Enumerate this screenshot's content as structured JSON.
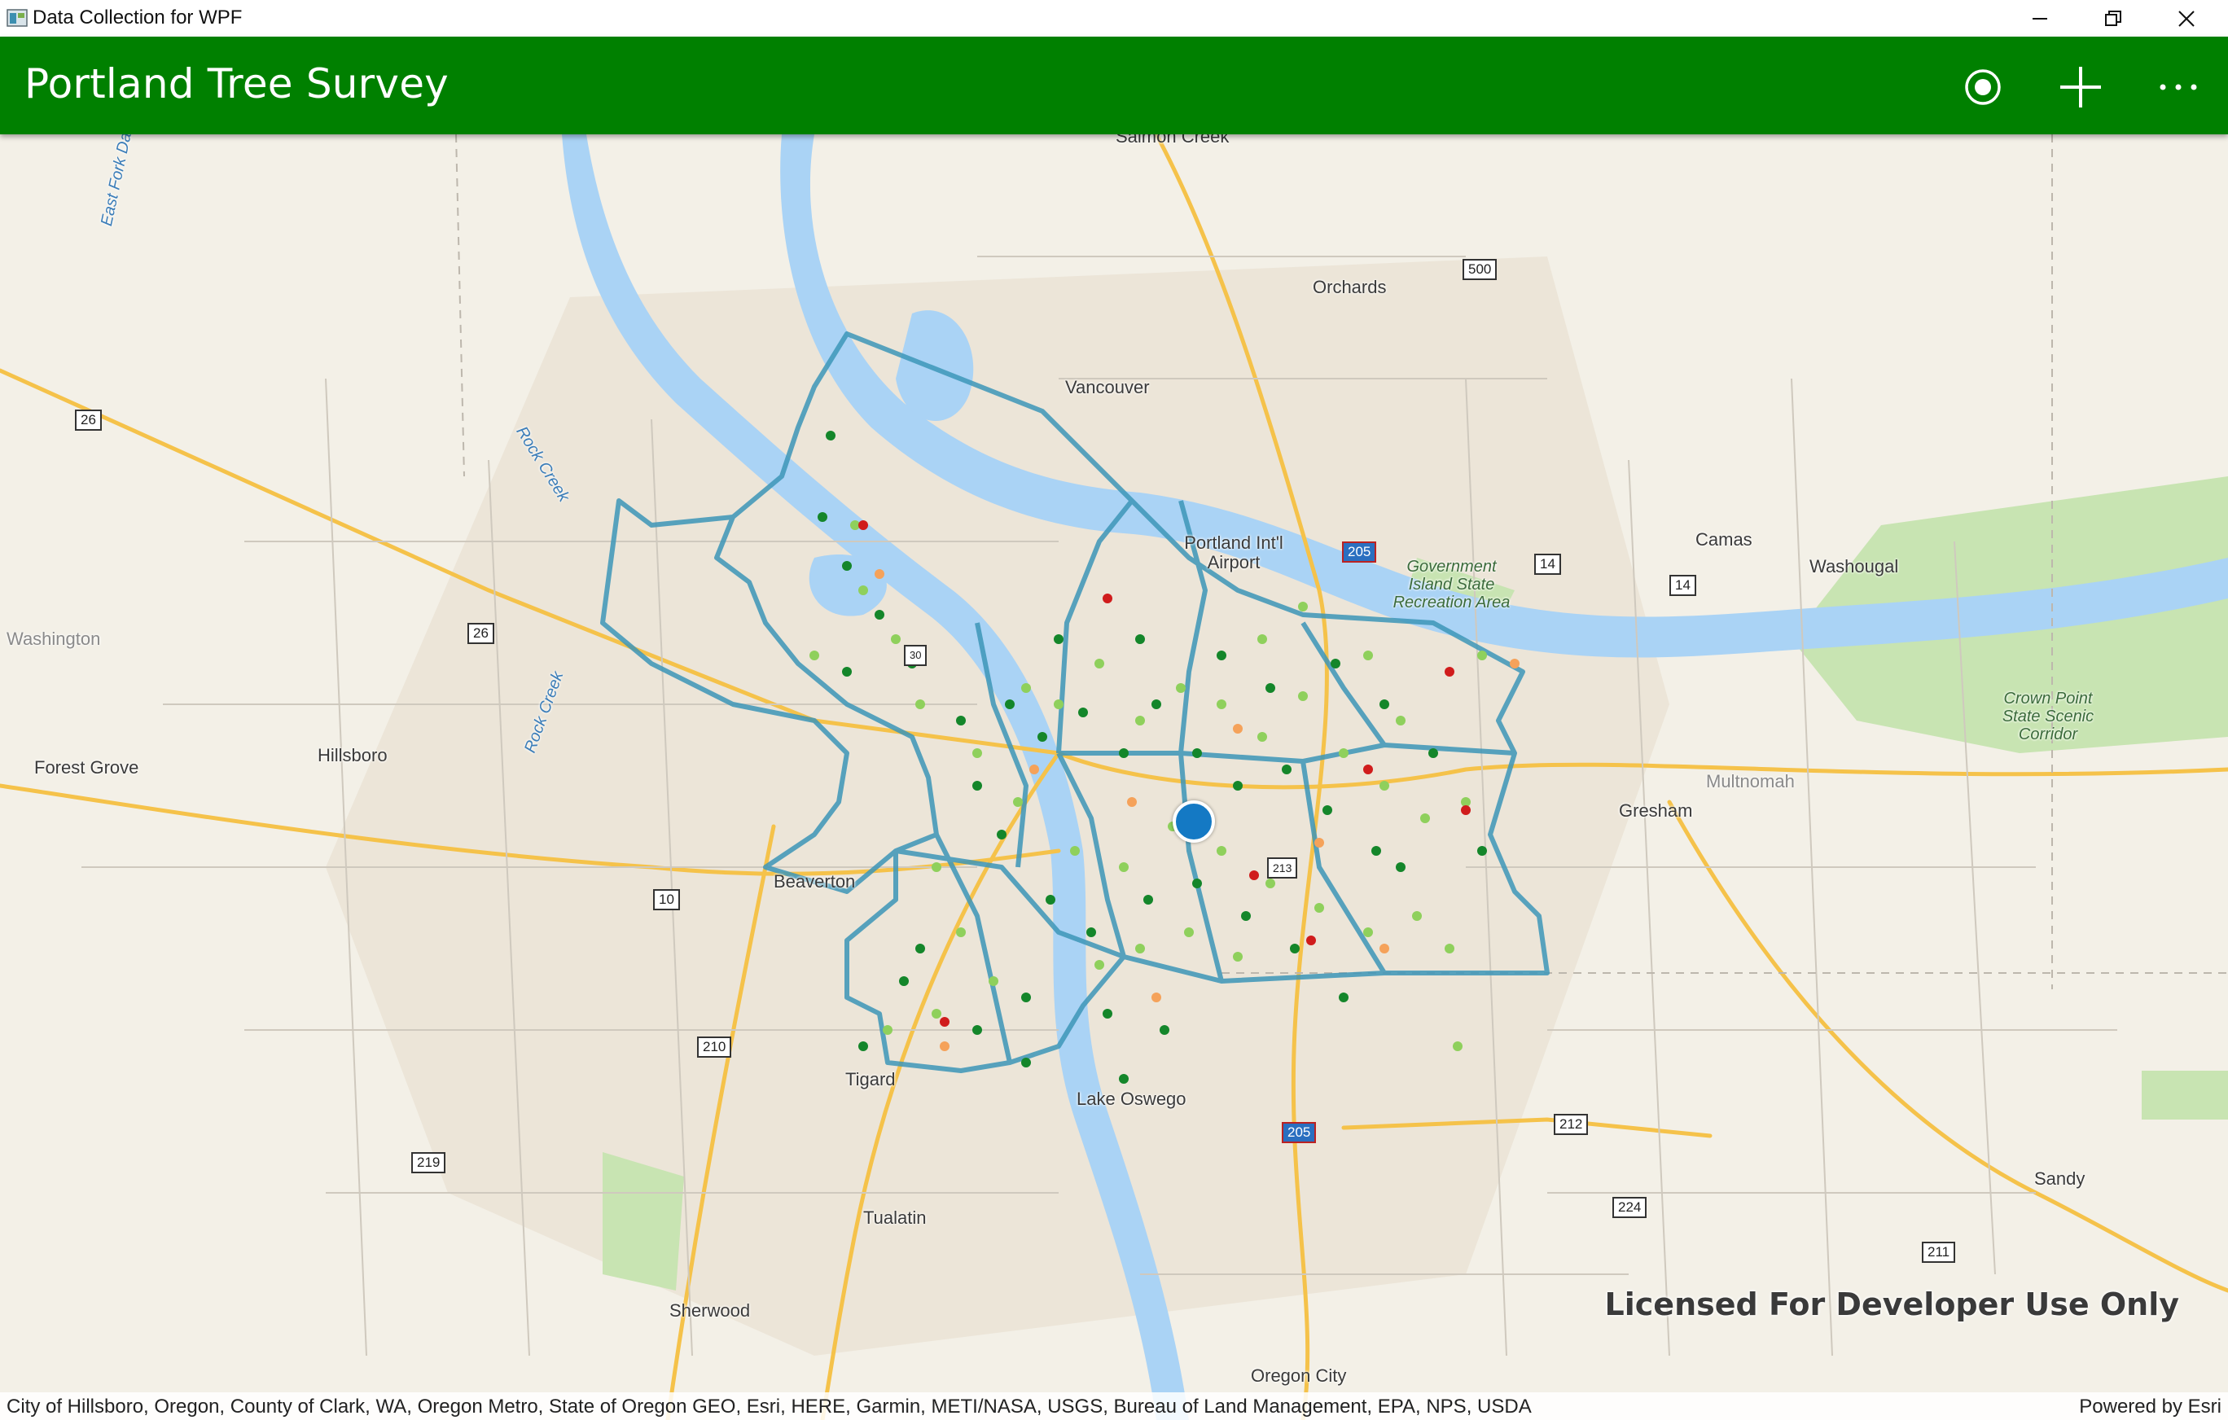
{
  "window": {
    "title": "Data Collection for WPF",
    "minimize_icon": "minimize-icon",
    "restore_icon": "restore-icon",
    "close_icon": "close-icon"
  },
  "header": {
    "title": "Portland Tree Survey",
    "actions": [
      {
        "icon": "locate-icon"
      },
      {
        "icon": "add-icon"
      },
      {
        "icon": "more-icon"
      }
    ],
    "color": "#008000"
  },
  "map": {
    "places": {
      "salmon_creek": "Salmon Creek",
      "orchards": "Orchards",
      "vancouver": "Vancouver",
      "portland_airport": "Portland Int'l Airport",
      "camas": "Camas",
      "washougal": "Washougal",
      "washington": "Washington",
      "forest_grove": "Forest Grove",
      "hillsboro": "Hillsboro",
      "beaverton": "Beaverton",
      "tigard": "Tigard",
      "lake_oswego": "Lake Oswego",
      "tualatin": "Tualatin",
      "sherwood": "Sherwood",
      "oregon_city": "Oregon City",
      "gresham": "Gresham",
      "multnomah": "Multnomah",
      "sandy": "Sandy"
    },
    "water": {
      "east_fork": "East Fork Da",
      "rock_creek_1": "Rock Creek",
      "rock_creek_2": "Rock Creek"
    },
    "parks": {
      "government_island": "Government Island State Recreation Area",
      "crown_point": "Crown Point State Scenic Corridor"
    },
    "shields": [
      "500",
      "26",
      "26",
      "30",
      "205",
      "14",
      "14",
      "10",
      "210",
      "219",
      "205",
      "212",
      "224",
      "211",
      "213"
    ],
    "colors": {
      "boundary": "#3d96b8",
      "tree_dark": "#14862a",
      "tree_light": "#8fd05c",
      "tree_orange": "#f5a25a",
      "tree_red": "#d01c1c",
      "location": "#1479c4",
      "water": "#aad3f5",
      "park": "#c5e3b0"
    },
    "license_text": "Licensed For Developer Use Only",
    "attribution": "City of Hillsboro, Oregon, County of Clark, WA, Oregon Metro, State of Oregon GEO, Esri, HERE, Garmin, METI/NASA, USGS, Bureau of Land Management, EPA, NPS, USDA",
    "powered_by": "Powered by Esri"
  }
}
